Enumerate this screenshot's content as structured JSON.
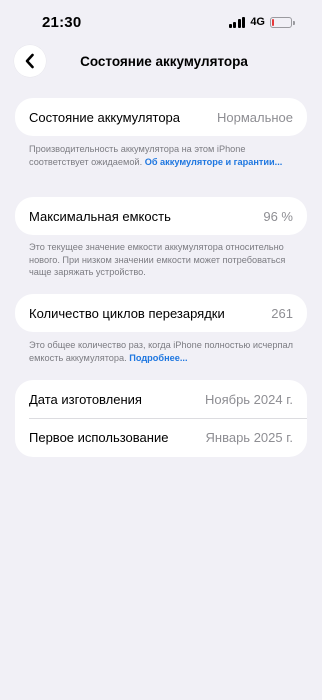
{
  "status_bar": {
    "time": "21:30",
    "network": "4G",
    "battery_level": 0.12,
    "battery_color": "#e5383b"
  },
  "nav": {
    "back_icon": "chevron-left-icon",
    "title": "Состояние аккумулятора"
  },
  "health": {
    "label": "Состояние аккумулятора",
    "value": "Нормальное",
    "note": "Производительность аккумулятора на этом iPhone соответствует ожидаемой.",
    "link": "Об аккумуляторе и гарантии..."
  },
  "capacity": {
    "label": "Максимальная емкость",
    "value": "96 %",
    "note": "Это текущее значение емкости аккумулятора относительно нового. При низком значении емкости может потребоваться чаще заряжать устройство."
  },
  "cycles": {
    "label": "Количество циклов перезарядки",
    "value": "261",
    "note": "Это общее количество раз, когда iPhone полностью исчерпал емкость аккумулятора.",
    "link": "Подробнее..."
  },
  "dates": {
    "manufacture_label": "Дата изготовления",
    "manufacture_value": "Ноябрь 2024 г.",
    "first_use_label": "Первое использование",
    "first_use_value": "Январь 2025 г."
  },
  "colors": {
    "background": "#f1f0f6",
    "link": "#1f77e0",
    "secondary_text": "#8e8e93"
  }
}
